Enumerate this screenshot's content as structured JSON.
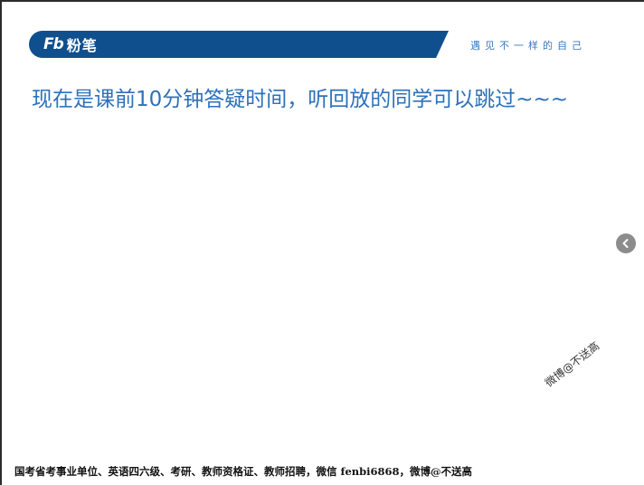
{
  "header": {
    "logo_mark": "Fb",
    "logo_text": "粉笔",
    "tagline": "遇见不一样的自己"
  },
  "slide": {
    "headline": "现在是课前10分钟答疑时间，听回放的同学可以跳过~~~"
  },
  "navigation": {
    "prev_icon": "chevron-left-icon"
  },
  "watermark": {
    "text": "微博@不送高"
  },
  "footer": {
    "text": "国考省考事业单位、英语四六级、考研、教师资格证、教师招聘，微信 fenbi6868，微博@不送高"
  },
  "colors": {
    "brand_blue": "#0f4f8e",
    "headline_blue": "#2e71b8",
    "nav_gray": "#8c8c8c"
  }
}
